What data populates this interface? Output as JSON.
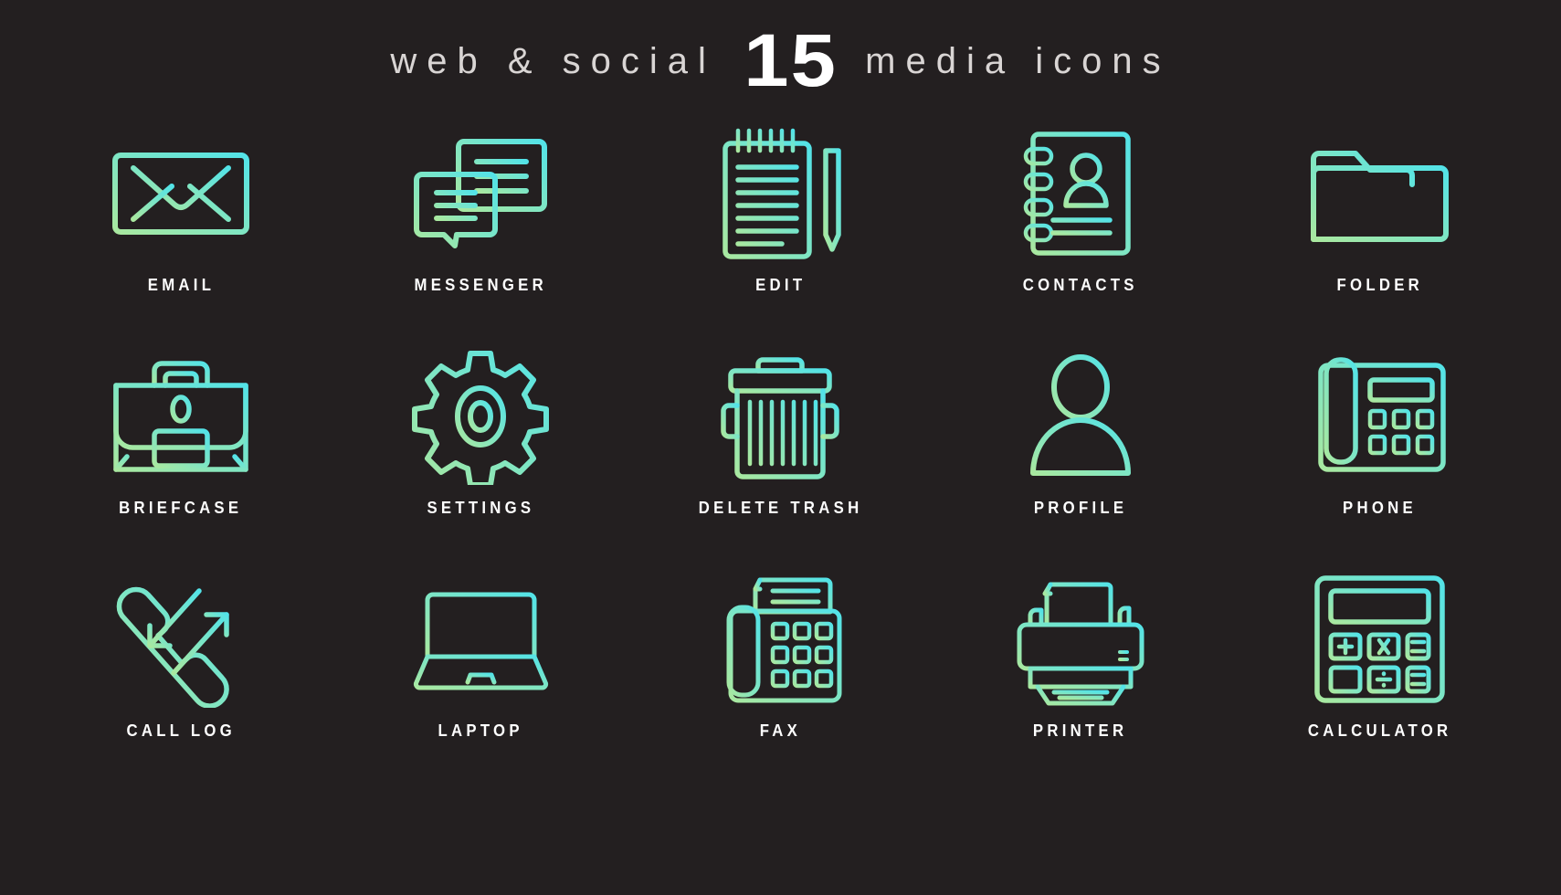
{
  "header": {
    "text_left": "web & social",
    "number": "15",
    "text_right": "media icons"
  },
  "colors": {
    "background": "#231f20",
    "gradient_start": "#a9e8a0",
    "gradient_end": "#53e3e8",
    "label_text": "#ffffff",
    "header_thin_text": "#d9d5d4"
  },
  "grid": {
    "columns": 5,
    "rows": 3
  },
  "icons": [
    {
      "label": "EMAIL",
      "icon": "envelope-icon"
    },
    {
      "label": "MESSENGER",
      "icon": "chat-bubbles-icon"
    },
    {
      "label": "EDIT",
      "icon": "notepad-pencil-icon"
    },
    {
      "label": "CONTACTS",
      "icon": "address-book-icon"
    },
    {
      "label": "FOLDER",
      "icon": "folder-icon"
    },
    {
      "label": "BRIEFCASE",
      "icon": "briefcase-icon"
    },
    {
      "label": "SETTINGS",
      "icon": "gear-icon"
    },
    {
      "label": "DELETE TRASH",
      "icon": "trash-can-icon"
    },
    {
      "label": "PROFILE",
      "icon": "person-icon"
    },
    {
      "label": "PHONE",
      "icon": "desk-phone-icon"
    },
    {
      "label": "CALL LOG",
      "icon": "handset-arrows-icon"
    },
    {
      "label": "LAPTOP",
      "icon": "laptop-icon"
    },
    {
      "label": "FAX",
      "icon": "fax-machine-icon"
    },
    {
      "label": "PRINTER",
      "icon": "printer-icon"
    },
    {
      "label": "CALCULATOR",
      "icon": "calculator-icon"
    }
  ]
}
